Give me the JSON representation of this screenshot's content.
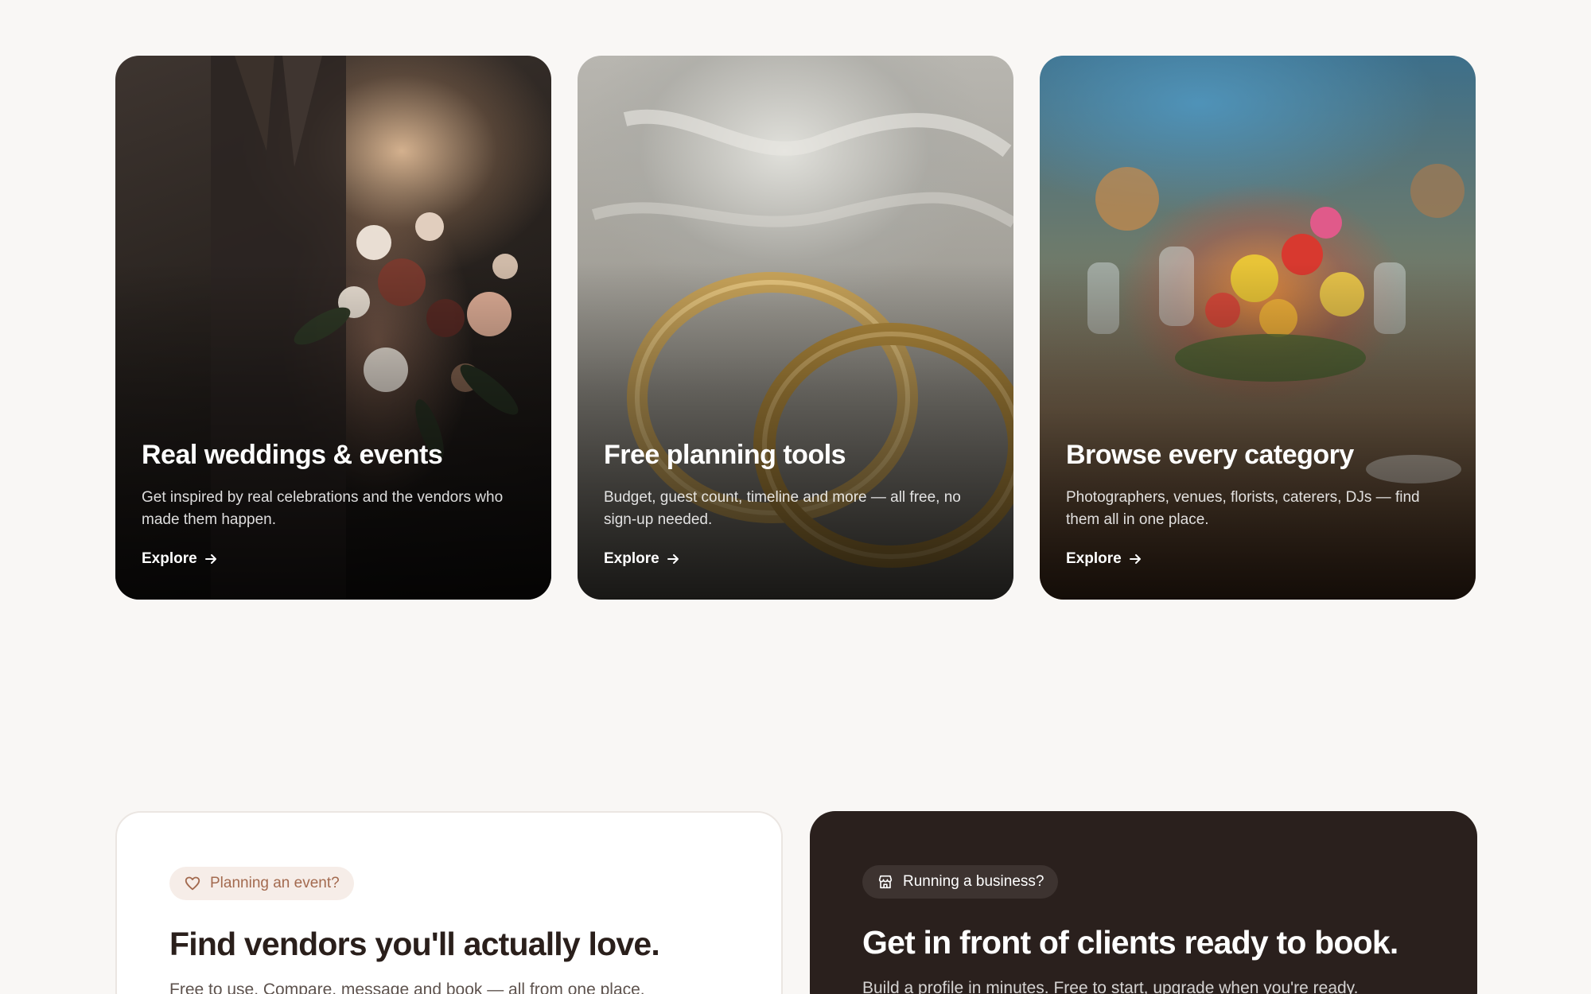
{
  "features": [
    {
      "title": "Real weddings & events",
      "description": "Get inspired by real celebrations and the vendors who made them happen.",
      "link_label": "Explore"
    },
    {
      "title": "Free planning tools",
      "description": "Budget, guest count, timeline and more — all free, no sign-up needed.",
      "link_label": "Explore"
    },
    {
      "title": "Browse every category",
      "description": "Photographers, venues, florists, caterers, DJs — find them all in one place.",
      "link_label": "Explore"
    }
  ],
  "cta": {
    "planner": {
      "pill_label": "Planning an event?",
      "title": "Find vendors you'll actually love.",
      "subtitle": "Free to use. Compare, message and book — all from one place."
    },
    "business": {
      "pill_label": "Running a business?",
      "title": "Get in front of clients ready to book.",
      "subtitle": "Build a profile in minutes. Free to start, upgrade when you're ready."
    }
  },
  "colors": {
    "background": "#f9f7f5",
    "dark_panel": "#2a201d",
    "accent": "#a36a4f"
  }
}
